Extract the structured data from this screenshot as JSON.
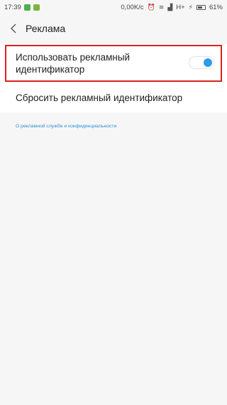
{
  "status_bar": {
    "time": "17:39",
    "net_speed": "0,00K/c",
    "network": "H+",
    "battery": "61%"
  },
  "header": {
    "title": "Реклама"
  },
  "settings": {
    "ad_id_label": "Использовать рекламный идентификатор",
    "ad_id_enabled": true,
    "reset_label": "Сбросить рекламный идентификатор"
  },
  "footer": {
    "privacy_link": "О рекламной службе и конфиденциальности"
  },
  "colors": {
    "accent": "#2e9be6",
    "highlight": "#d92222",
    "link": "#2a8fd8"
  }
}
